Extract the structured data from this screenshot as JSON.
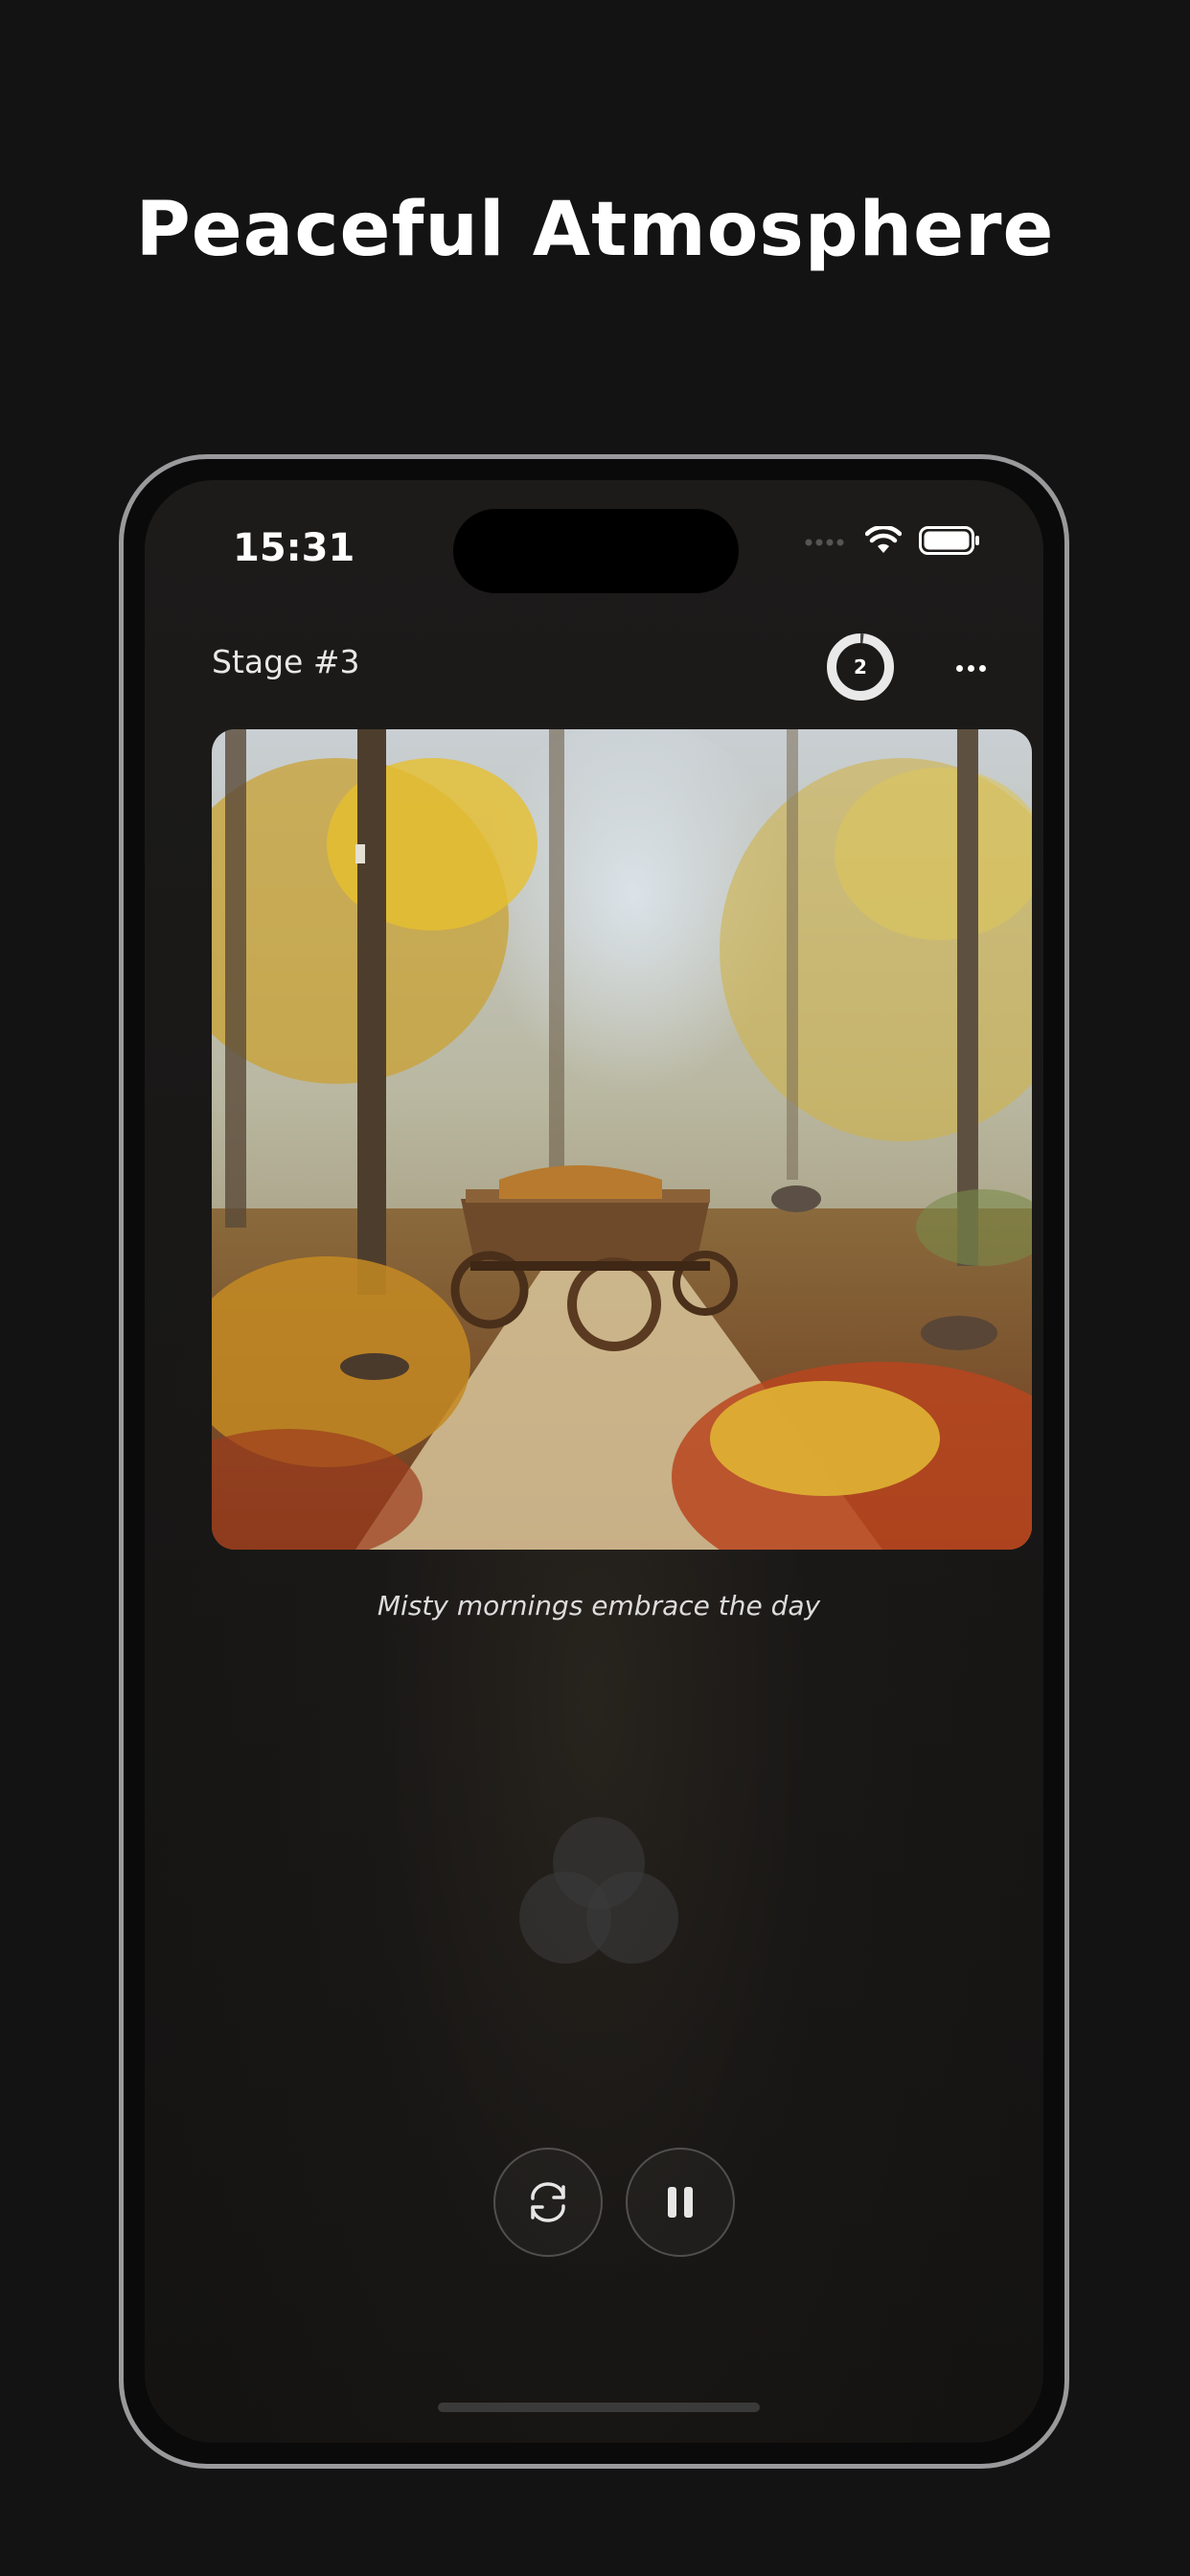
{
  "headline": "Peaceful Atmosphere",
  "status_bar": {
    "time": "15:31"
  },
  "header": {
    "stage_label": "Stage #3",
    "timer_count": "2"
  },
  "artwork": {
    "caption": "Misty mornings embrace the day"
  },
  "colors": {
    "background": "#141314",
    "accent_white": "#ffffff",
    "caption_gray": "#dcdcdc"
  },
  "icons": {
    "more": "more-horizontal-icon",
    "restart": "refresh-icon",
    "pause": "pause-icon",
    "wifi": "wifi-icon",
    "battery": "battery-icon",
    "signal": "cellular-signal-icon"
  }
}
